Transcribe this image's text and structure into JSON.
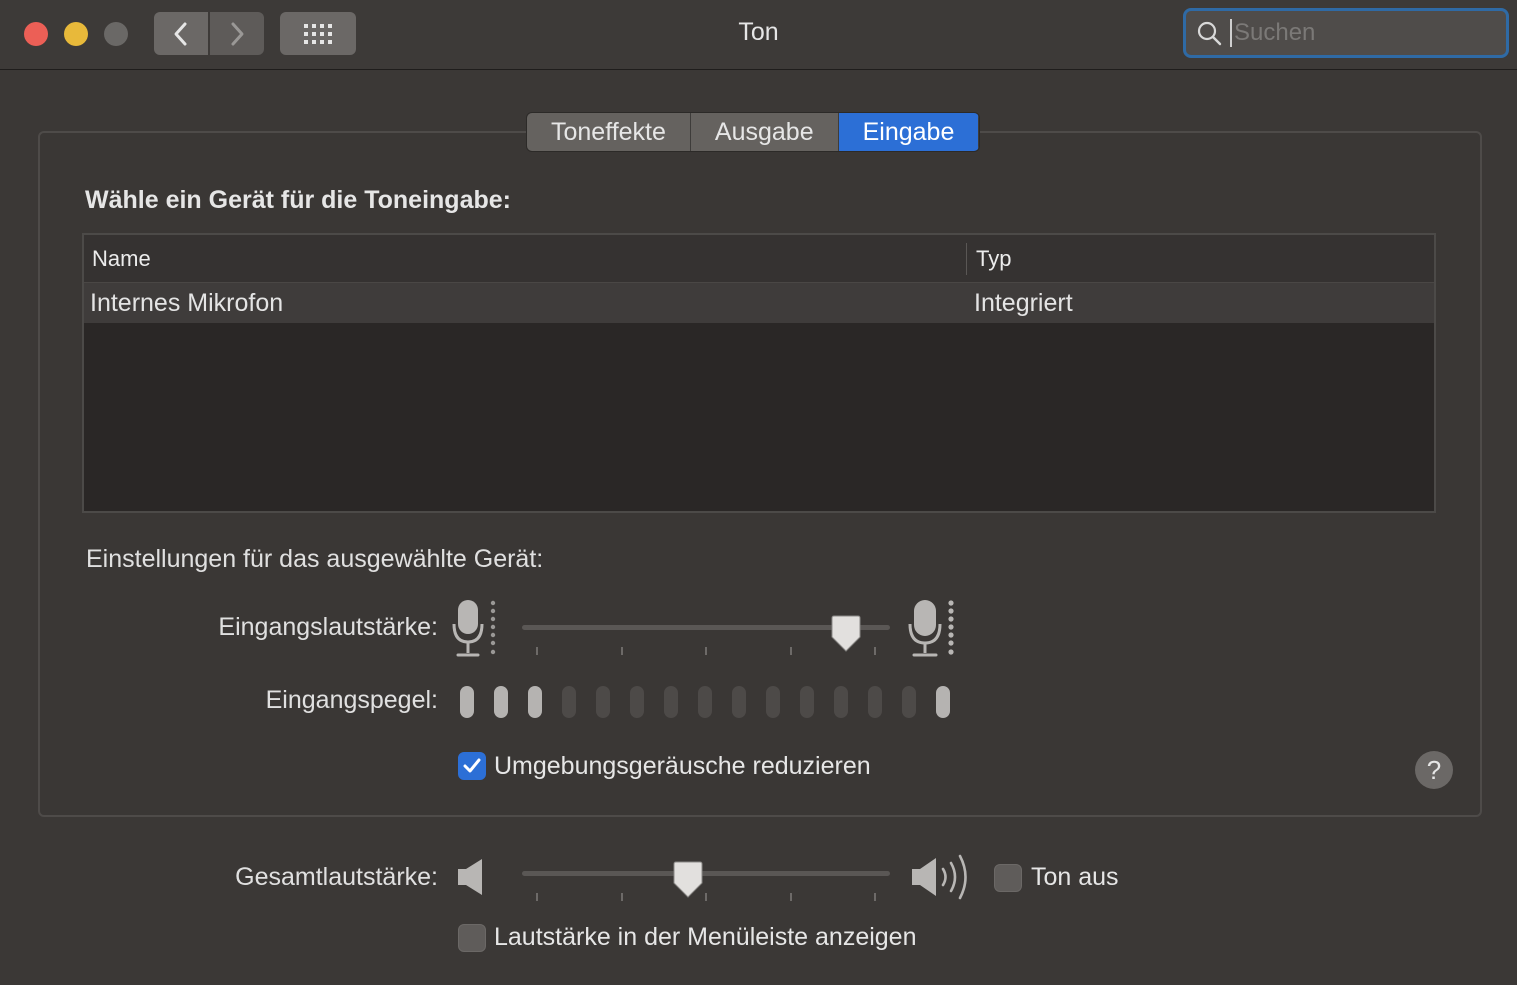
{
  "window": {
    "title": "Ton"
  },
  "search": {
    "placeholder": "Suchen",
    "value": ""
  },
  "tabs": [
    {
      "label": "Toneffekte",
      "active": false
    },
    {
      "label": "Ausgabe",
      "active": false
    },
    {
      "label": "Eingabe",
      "active": true
    }
  ],
  "input": {
    "heading": "Wähle ein Gerät für die Toneingabe:",
    "columns": {
      "name": "Name",
      "type": "Typ"
    },
    "devices": [
      {
        "name": "Internes Mikrofon",
        "type": "Integriert",
        "selected": true
      }
    ],
    "settings_label": "Einstellungen für das ausgewählte Gerät:",
    "volume_label": "Eingangslautstärke:",
    "volume_level": 0.88,
    "level_label": "Eingangspegel:",
    "level_lit": 3,
    "level_total": 15,
    "noise_label": "Umgebungsgeräusche reduzieren",
    "noise_checked": true
  },
  "output": {
    "volume_label": "Gesamtlautstärke:",
    "volume_level": 0.45,
    "mute_label": "Ton aus",
    "mute_checked": false,
    "menubar_label": "Lautstärke in der Menüleiste anzeigen",
    "menubar_checked": false
  },
  "help": {
    "label": "?"
  },
  "colors": {
    "accent": "#2c6fd6",
    "window_bg": "#3b3836",
    "close": "#ec5f56",
    "minimize": "#e8b93a"
  },
  "icons": [
    "back-icon",
    "forward-icon",
    "grid-icon",
    "search-icon",
    "microphone-icon",
    "speaker-icon",
    "checkmark-icon"
  ]
}
